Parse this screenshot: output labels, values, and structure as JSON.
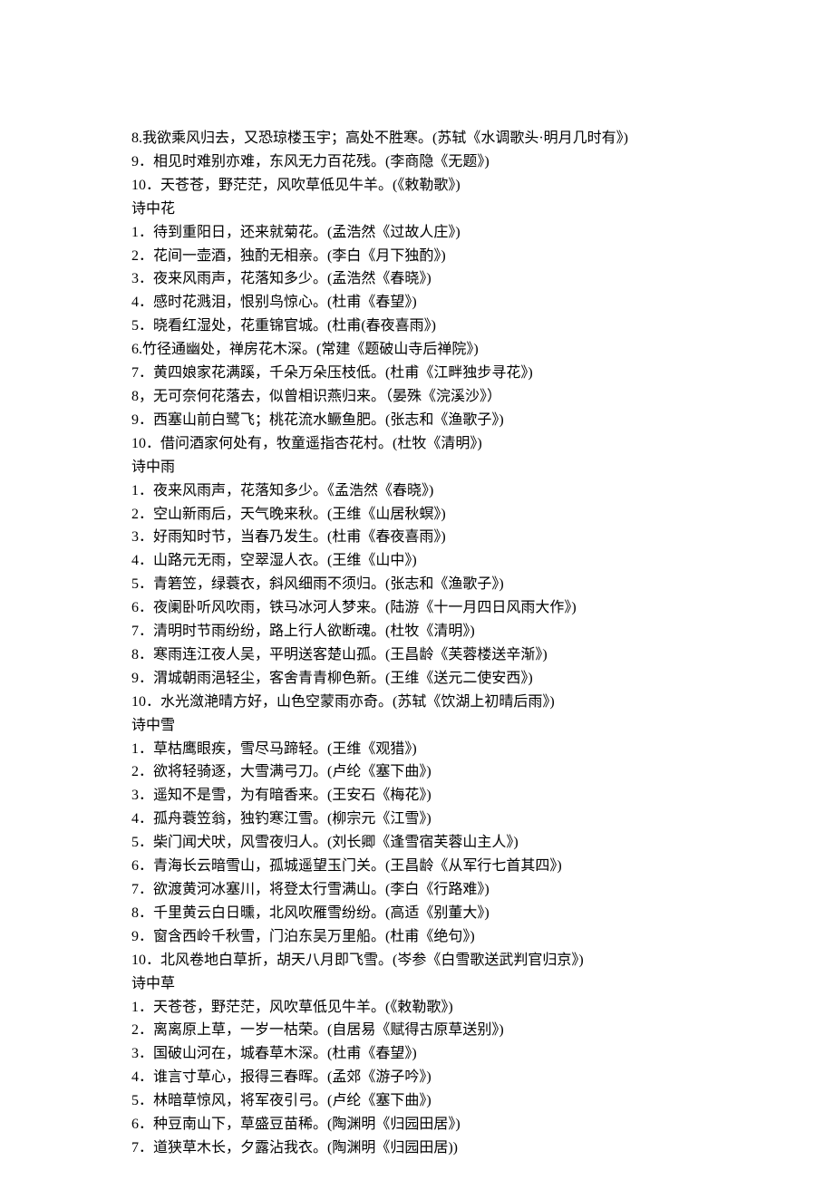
{
  "lines": [
    "8.我欲乘风归去，又恐琼楼玉宇；高处不胜寒。(苏轼《水调歌头·明月几时有》)",
    "9．相见时难别亦难，东风无力百花残。(李商隐《无题》)",
    "10．天苍苍，野茫茫，风吹草低见牛羊。(《敕勒歌》)",
    "诗中花",
    "1．待到重阳日，还来就菊花。(孟浩然《过故人庄》)",
    "2．花间一壶酒，独酌无相亲。(李白《月下独酌》)",
    "3．夜来风雨声，花落知多少。(孟浩然《春晓》)",
    "4．感时花溅泪，恨别鸟惊心。(杜甫《春望》)",
    "5．晓看红湿处，花重锦官城。(杜甫(春夜喜雨》)",
    "6.竹径通幽处，禅房花木深。(常建《题破山寺后禅院》)",
    "7．黄四娘家花满蹊，千朵万朵压枝低。(杜甫《江畔独步寻花》)",
    "8，无可奈何花落去，似曾相识燕归来。（晏殊《浣溪沙》）",
    "9．西塞山前白鹭飞；桃花流水鳜鱼肥。(张志和《渔歌子》)",
    "10．借问酒家何处有，牧童遥指杏花村。(杜牧《清明》)",
    "诗中雨",
    "1．夜来风雨声，花落知多少。《孟浩然《春晓》)",
    "2．空山新雨后，天气晚来秋。(王维《山居秋螟》)",
    "3．好雨知时节，当春乃发生。(杜甫《春夜喜雨》)",
    "4．山路元无雨，空翠湿人衣。(王维《山中》)",
    "5．青箬笠，绿蓑衣，斜风细雨不须归。(张志和《渔歌子》)",
    "6．夜阑卧听风吹雨，铁马冰河人梦来。(陆游《十一月四日风雨大作》)",
    "7．清明时节雨纷纷，路上行人欲断魂。(杜牧《清明》)",
    "8．寒雨连江夜人吴，平明送客楚山孤。(王昌龄《芙蓉楼送辛渐》)",
    "9．渭城朝雨浥轻尘，客舍青青柳色新。(王维《送元二使安西》)",
    "10．水光潋滟晴方好，山色空蒙雨亦奇。(苏轼《饮湖上初晴后雨》)",
    "诗中雪",
    "1．草枯鹰眼疾，雪尽马蹄轻。(王维《观猎》)",
    "2．欲将轻骑逐，大雪满弓刀。(卢纶《塞下曲》)",
    "3．遥知不是雪，为有暗香来。(王安石《梅花》)",
    "4．孤舟蓑笠翁，独钓寒江雪。(柳宗元《江雪》)",
    "5．柴门闻犬吠，风雪夜归人。(刘长卿《逢雪宿芙蓉山主人》)",
    "6．青海长云暗雪山，孤城遥望玉门关。(王昌龄《从军行七首其四》)",
    "7．欲渡黄河冰塞川，将登太行雪满山。(李白《行路难》)",
    "8．千里黄云白日曛，北风吹雁雪纷纷。(高适《别董大》)",
    "9．窗含西岭千秋雪，门泊东吴万里船。(杜甫《绝句》)",
    "10．北风卷地白草折，胡天八月即飞雪。(岑参《白雪歌送武判官归京》)",
    "诗中草",
    "1．天苍苍，野茫茫，风吹草低见牛羊。(《敕勒歌》)",
    "2．离离原上草，一岁一枯荣。(自居易《赋得古原草送别》)",
    "3．国破山河在，城春草木深。(杜甫《春望》)",
    "4．谁言寸草心，报得三春晖。(孟郊《游子吟》)",
    "5．林暗草惊风，将军夜引弓。(卢纶《塞下曲》)",
    "6．种豆南山下，草盛豆苗稀。(陶渊明《归园田居》)",
    "7．道狭草木长，夕露沾我衣。(陶渊明《归园田居))"
  ]
}
